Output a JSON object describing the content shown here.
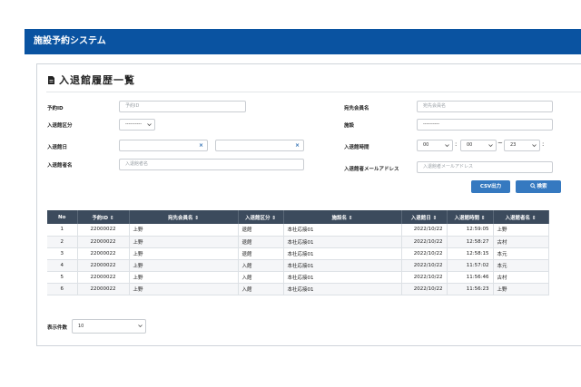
{
  "app": {
    "title": "施設予約システム"
  },
  "page": {
    "title": "入退館履歴一覧"
  },
  "form": {
    "reservation_id": {
      "label": "予約ID",
      "placeholder": "予約ID"
    },
    "entry_type": {
      "label": "入退館区分",
      "value": "----------"
    },
    "entry_date": {
      "label": "入退館日",
      "clear_mark": "×"
    },
    "visitor_name": {
      "label": "入退館者名",
      "placeholder": "入退館者名"
    },
    "destination_member": {
      "label": "宛先会員名",
      "placeholder": "宛先会員名"
    },
    "facility": {
      "label": "施設",
      "value": "----------"
    },
    "entry_time": {
      "label": "入退館時間",
      "from_hour": "00",
      "from_minute": "00",
      "tilde": "~",
      "to_hour": "23",
      "colon": ":"
    },
    "visitor_email": {
      "label": "入退館者メールアドレス",
      "placeholder": "入退館者メールアドレス"
    },
    "csv_button": "CSV出力",
    "search_button": "検索"
  },
  "table": {
    "columns": [
      "No",
      "予約ID ⇕",
      "宛先会員名 ⇕",
      "入退館区分 ⇕",
      "施設名 ⇕",
      "入退館日 ⇕",
      "入退館時間 ⇕",
      "入退館者名 ⇕"
    ],
    "rows": [
      [
        "1",
        "22000022",
        "上野",
        "退館",
        "本社応接01",
        "2022/10/22",
        "12:59:05",
        "上野"
      ],
      [
        "2",
        "22000022",
        "上野",
        "退館",
        "本社応接01",
        "2022/10/22",
        "12:58:27",
        "古村"
      ],
      [
        "3",
        "22000022",
        "上野",
        "退館",
        "本社応接01",
        "2022/10/22",
        "12:58:15",
        "本元"
      ],
      [
        "4",
        "22000022",
        "上野",
        "入館",
        "本社応接01",
        "2022/10/22",
        "11:57:02",
        "本元"
      ],
      [
        "5",
        "22000022",
        "上野",
        "入館",
        "本社応接01",
        "2022/10/22",
        "11:56:46",
        "古村"
      ],
      [
        "6",
        "22000022",
        "上野",
        "入館",
        "本社応接01",
        "2022/10/22",
        "11:56:23",
        "上野"
      ]
    ]
  },
  "pagination": {
    "label": "表示件数",
    "value": "10"
  },
  "colors": {
    "header": "#0a53a1",
    "table_header": "#3c4b5d",
    "button": "#3579c0"
  }
}
